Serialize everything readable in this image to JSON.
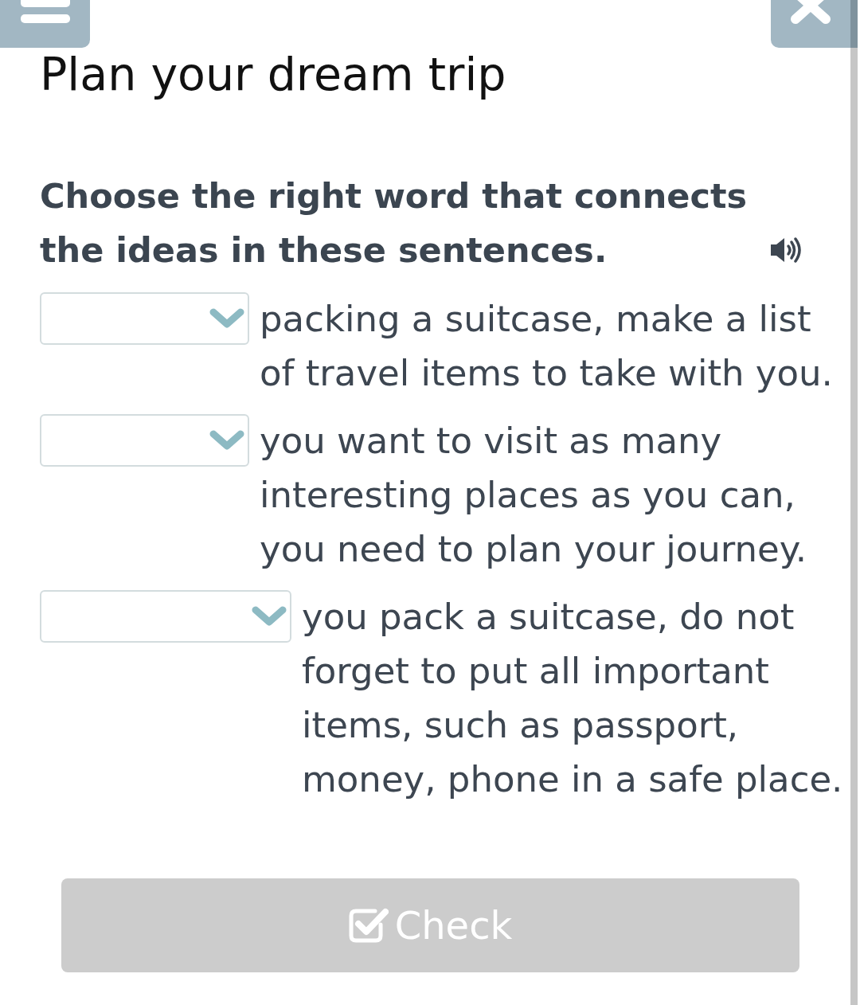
{
  "title": "Plan your dream trip",
  "instruction": {
    "text": "Choose the right word that connects the ideas in these sentences."
  },
  "sentences": [
    {
      "text": "packing a suitcase, make a list of travel items to take with you."
    },
    {
      "text": "you want to visit as many interesting places as you can, you need to plan your journey."
    },
    {
      "text": "you pack a suitcase, do not forget to put all important items, such as passport, money, phone in a safe place."
    }
  ],
  "check_button": {
    "label": "Check",
    "disabled": true
  }
}
